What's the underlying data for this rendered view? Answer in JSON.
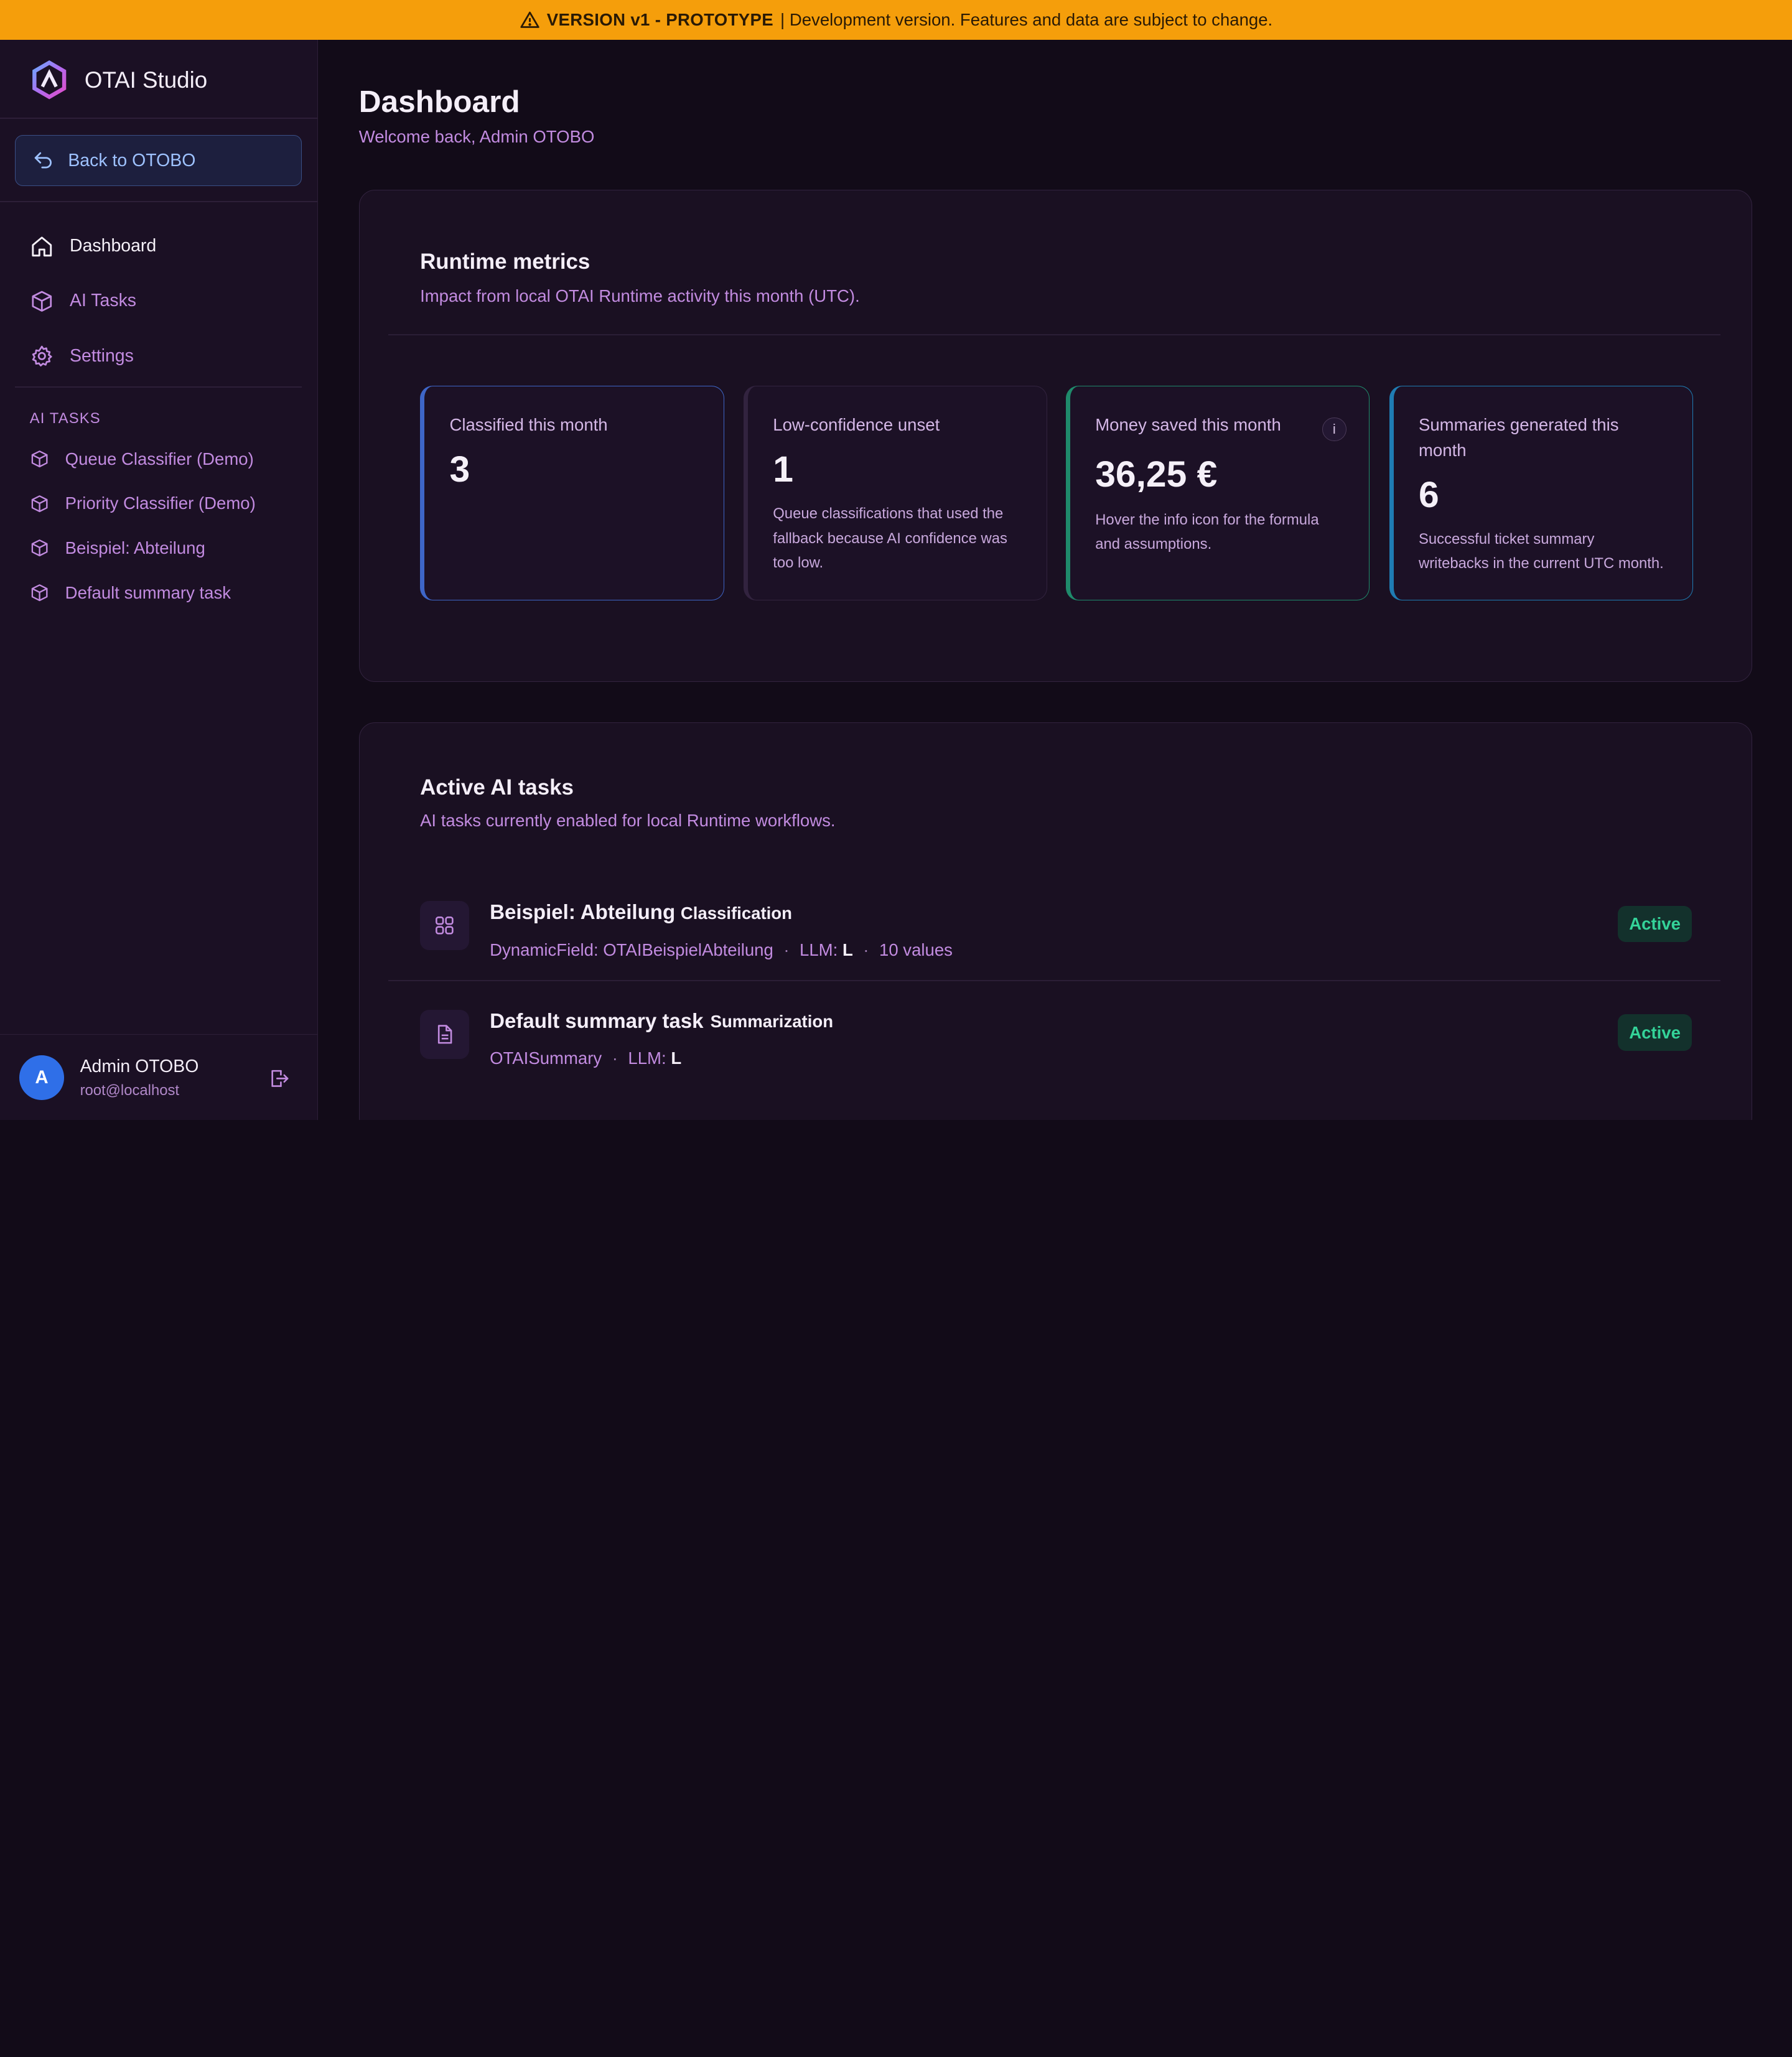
{
  "banner": {
    "version": "VERSION v1 - PROTOTYPE",
    "text": "| Development version. Features and data are subject to change.",
    "icon": "warning-triangle-icon",
    "color": "#f59e0b"
  },
  "sidebar": {
    "app_name": "OTAI Studio",
    "back_label": "Back to OTOBO",
    "nav": [
      {
        "label": "Dashboard",
        "icon": "home-icon",
        "active": true
      },
      {
        "label": "AI Tasks",
        "icon": "cube-icon"
      },
      {
        "label": "Settings",
        "icon": "gear-icon"
      }
    ],
    "section_label": "AI TASKS",
    "tasks": [
      {
        "label": "Queue Classifier (Demo)"
      },
      {
        "label": "Priority Classifier (Demo)"
      },
      {
        "label": "Beispiel: Abteilung"
      },
      {
        "label": "Default summary task"
      }
    ],
    "user": {
      "initial": "A",
      "name": "Admin OTOBO",
      "email": "root@localhost"
    }
  },
  "header": {
    "title": "Dashboard",
    "subtitle": "Welcome back, Admin OTOBO"
  },
  "metrics": {
    "title": "Runtime metrics",
    "subtitle": "Impact from local OTAI Runtime activity this month (UTC).",
    "cards": [
      {
        "label": "Classified this month",
        "value": "3",
        "desc": ""
      },
      {
        "label": "Low-confidence unset",
        "value": "1",
        "desc": "Queue classifications that used the fallback because AI confidence was too low."
      },
      {
        "label": "Money saved this month",
        "value": "36,25 €",
        "desc": "Hover the info icon for the formula and assumptions.",
        "info": "i"
      },
      {
        "label": "Summaries generated this month",
        "value": "6",
        "desc": "Successful ticket summary writebacks in the current UTC month."
      }
    ]
  },
  "active_tasks": {
    "title": "Active AI tasks",
    "subtitle": "AI tasks currently enabled for local Runtime workflows.",
    "rows": [
      {
        "name": "Beispiel: Abteilung",
        "type": "Classification",
        "icon": "grid-icon",
        "meta_field": "DynamicField: OTAIBeispielAbteilung",
        "llm_label": "LLM:",
        "llm_value": "L",
        "extra": "10 values",
        "status": "Active"
      },
      {
        "name": "Default summary task",
        "type": "Summarization",
        "icon": "document-icon",
        "meta_field": "OTAISummary",
        "llm_label": "LLM:",
        "llm_value": "L",
        "status": "Active"
      }
    ]
  }
}
